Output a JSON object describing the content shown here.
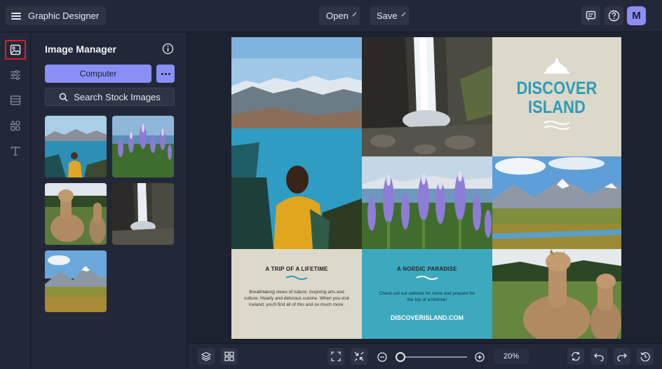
{
  "header": {
    "app_title": "Graphic Designer",
    "open_label": "Open",
    "save_label": "Save",
    "avatar_initial": "M"
  },
  "rail": {
    "items": [
      "image-manager",
      "adjustments",
      "layouts",
      "graphics",
      "text"
    ]
  },
  "panel": {
    "title": "Image Manager",
    "computer_label": "Computer",
    "search_label": "Search Stock Images",
    "thumbnails": [
      "lake-hiker",
      "lupines",
      "alpacas",
      "waterfall",
      "mountain-valley"
    ]
  },
  "canvas": {
    "discover_line1": "DISCOVER",
    "discover_line2": "ISLAND",
    "card1_title": "A TRIP OF A LIFETIME",
    "card1_body": "Breathtaking views of nature. Inspiring arts and culture. Hearty and delicious cuisine. When you visit Iceland, you'll find all of this and so much more.",
    "card2_title": "A NORDIC PARADISE",
    "card2_body": "Check out our website for more and prepare for the trip of a lifetime!",
    "card2_url": "DISCOVERISLAND.COM"
  },
  "footer": {
    "zoom_value": "20%",
    "zoom_level": 0.05
  },
  "colors": {
    "accent": "#8b8ff5",
    "teal_card": "#3da9bf",
    "beige_card": "#dcd9ca",
    "heading_teal": "#2f9bb5",
    "active_outline": "#e21b24"
  }
}
